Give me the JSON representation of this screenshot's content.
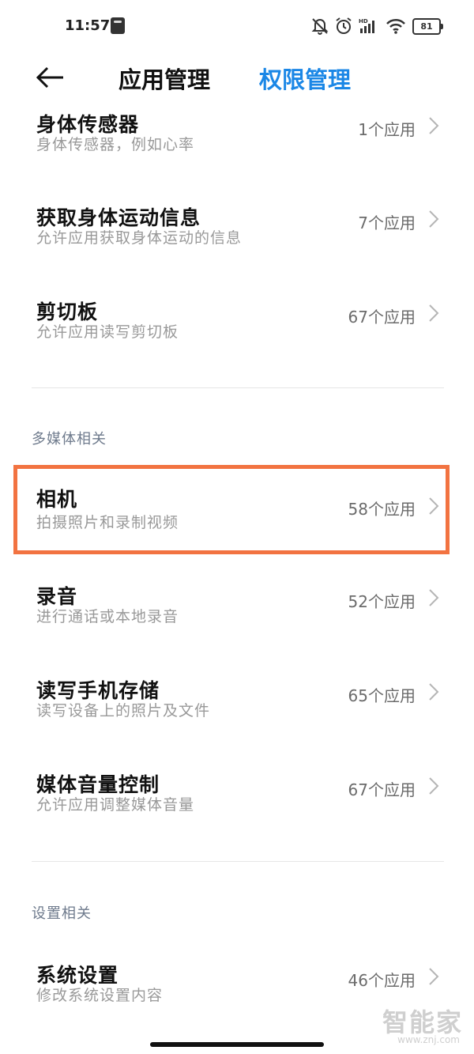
{
  "status_bar": {
    "time": "11:57",
    "battery": "81",
    "icons": [
      "app-notification-icon",
      "bell-muted-icon",
      "alarm-icon",
      "hd-signal-icon",
      "wifi-icon",
      "battery-icon"
    ],
    "hd_label": "HD"
  },
  "header": {
    "tab_app": "应用管理",
    "tab_permissions": "权限管理",
    "active_color": "#1b87e6"
  },
  "sections": {
    "media": "多媒体相关",
    "settings": "设置相关"
  },
  "items": [
    {
      "title": "身体传感器",
      "desc": "身体传感器，例如心率",
      "count": "1个应用"
    },
    {
      "title": "获取身体运动信息",
      "desc": "允许应用获取身体运动的信息",
      "count": "7个应用"
    },
    {
      "title": "剪切板",
      "desc": "允许应用读写剪切板",
      "count": "67个应用"
    },
    {
      "title": "相机",
      "desc": "拍摄照片和录制视频",
      "count": "58个应用"
    },
    {
      "title": "录音",
      "desc": "进行通话或本地录音",
      "count": "52个应用"
    },
    {
      "title": "读写手机存储",
      "desc": "读写设备上的照片及文件",
      "count": "65个应用"
    },
    {
      "title": "媒体音量控制",
      "desc": "允许应用调整媒体音量",
      "count": "67个应用"
    },
    {
      "title": "系统设置",
      "desc": "修改系统设置内容",
      "count": "46个应用"
    }
  ],
  "highlight_color": "#f27341",
  "watermark": {
    "text": "智能家",
    "url": "www.znj.com"
  }
}
